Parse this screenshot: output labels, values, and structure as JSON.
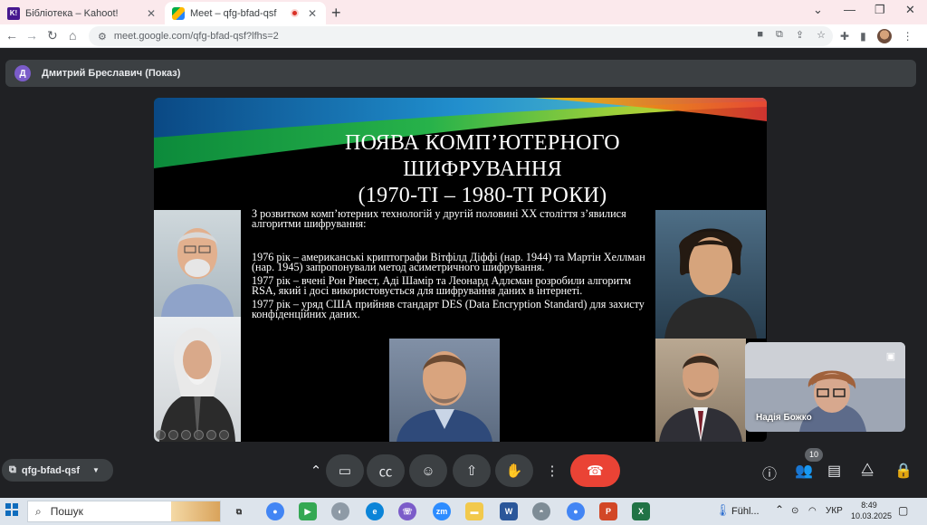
{
  "browser": {
    "tabs": [
      {
        "title": "Бібліотека – Kahoot!",
        "favicon": "kahoot-icon",
        "favicon_text": "K!"
      },
      {
        "title": "Meet – qfg-bfad-qsf",
        "favicon": "meet-icon"
      }
    ],
    "url": "meet.google.com/qfg-bfad-qsf?lfhs=2"
  },
  "meet": {
    "presenter_initial": "Д",
    "presenter_label": "Дмитрий Бреславич (Показ)",
    "meeting_code": "qfg-bfad-qsf",
    "participant_count": "10",
    "self_name": "Надія Божко",
    "end_call_color": "#ea4335"
  },
  "slide": {
    "title_line1": "ПОЯВА КОМП’ЮТЕРНОГО",
    "title_line2": "ШИФРУВАННЯ",
    "title_line3": "(1970-ТІ – 1980-ТІ РОКИ)",
    "intro": "З розвитком комп’ютерних технологій у другій половині ХХ століття з’явилися алгоритми шифрування:",
    "p1": "1976 рік – американські криптографи Вітфілд Діффі (нар. 1944) та Мартін Хеллман (нар. 1945) запропонували метод асиметричного шифрування.",
    "p2": "1977 рік – вчені Рон Рівест, Аді Шамір та Леонард Адлєман розробили алгоритм RSA, який і досі використовується для шифрування даних в інтернеті.",
    "p3": "1977 рік – уряд США прийняв стандарт DES (Data Encryption Standard) для захисту конфіденційних даних."
  },
  "taskbar": {
    "search_label": "Пошук",
    "weather": "Fühl...",
    "language": "УКР",
    "time": "8:49",
    "date": "10.03.2025"
  }
}
